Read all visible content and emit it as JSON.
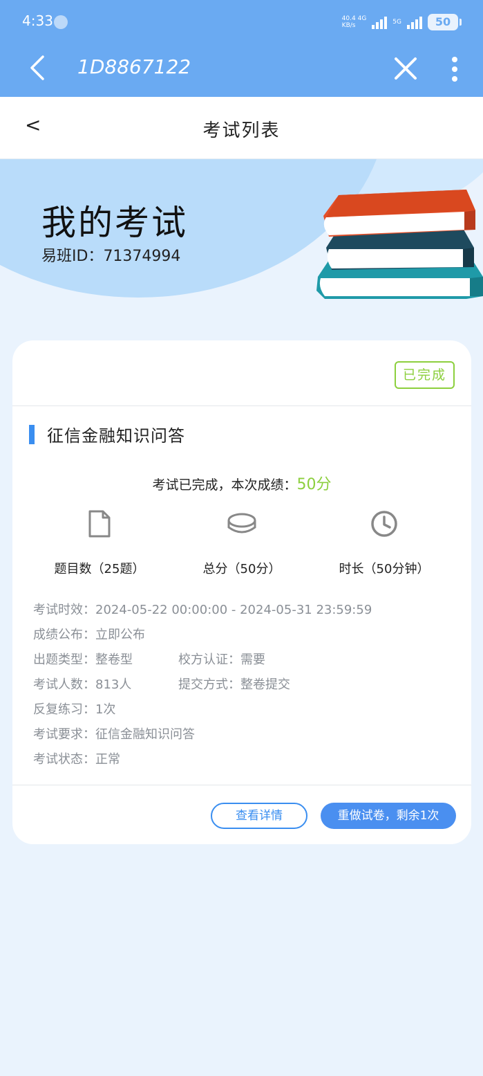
{
  "status_bar": {
    "time": "4:33",
    "net_speed_top": "40.4",
    "net_speed_bottom": "KB/s",
    "network_label_1": "4G",
    "network_label_2": "5G",
    "battery": "50"
  },
  "app_bar": {
    "title": "1D8867122",
    "back_icon": "chevron-left-icon",
    "close_icon": "close-icon",
    "more_icon": "more-vertical-icon"
  },
  "page_header": {
    "back_glyph": "<",
    "title": "考试列表"
  },
  "banner": {
    "title": "我的考试",
    "id_label": "易班ID：",
    "id_value": "71374994"
  },
  "card": {
    "status_badge": "已完成",
    "exam_name": "征信金融知识问答",
    "result_prefix": "考试已完成，本次成绩：",
    "result_score": "50分",
    "stats": [
      {
        "icon": "document-icon",
        "label": "题目数（25题）"
      },
      {
        "icon": "coin-icon",
        "label": "总分（50分）"
      },
      {
        "icon": "clock-icon",
        "label": "时长（50分钟）"
      }
    ],
    "info": {
      "validity_label": "考试时效：",
      "validity_value": "2024-05-22 00:00:00 - 2024-05-31 23:59:59",
      "publish_label": "成绩公布：",
      "publish_value": "立即公布",
      "type_label": "出题类型：",
      "type_value": "整卷型",
      "cert_label": "校方认证：",
      "cert_value": "需要",
      "count_label": "考试人数：",
      "count_value": "813人",
      "submit_label": "提交方式：",
      "submit_value": "整卷提交",
      "practice_label": "反复练习：",
      "practice_value": "1次",
      "require_label": "考试要求：",
      "require_value": "征信金融知识问答",
      "state_label": "考试状态：",
      "state_value": "正常"
    },
    "detail_button": "查看详情",
    "redo_button": "重做试卷，剩余1次"
  },
  "colors": {
    "topbar": "#6aaaf2",
    "accent_blue": "#3a8ef0",
    "success_green": "#8ccf3d",
    "page_bg": "#eaf3fd"
  }
}
